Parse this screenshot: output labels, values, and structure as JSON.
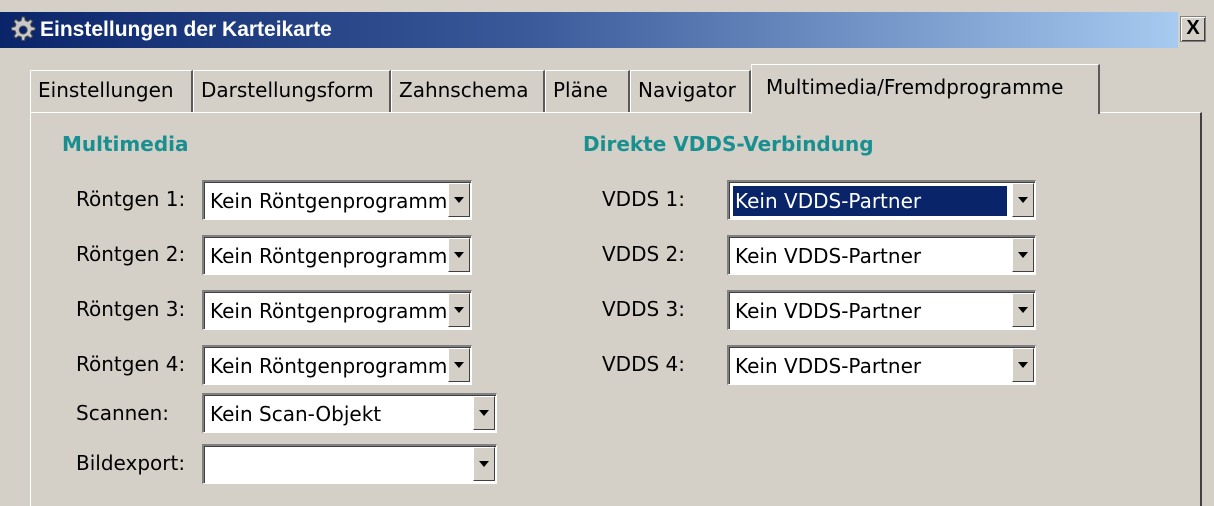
{
  "window": {
    "title": "Einstellungen der Karteikarte",
    "close_label": "X",
    "icon": "gear-icon"
  },
  "tabs": [
    {
      "label": "Einstellungen"
    },
    {
      "label": "Darstellungsform"
    },
    {
      "label": "Zahnschema"
    },
    {
      "label": "Pläne"
    },
    {
      "label": "Navigator"
    },
    {
      "label": "Multimedia/Fremdprogramme",
      "active": true
    }
  ],
  "multimedia": {
    "heading": "Multimedia",
    "fields": [
      {
        "label": "Röntgen 1:",
        "value": "Kein Röntgenprogramm"
      },
      {
        "label": "Röntgen 2:",
        "value": "Kein Röntgenprogramm"
      },
      {
        "label": "Röntgen 3:",
        "value": "Kein Röntgenprogramm"
      },
      {
        "label": "Röntgen 4:",
        "value": "Kein Röntgenprogramm"
      },
      {
        "label": "Scannen:",
        "value": "Kein Scan-Objekt"
      },
      {
        "label": "Bildexport:",
        "value": ""
      }
    ]
  },
  "vdds": {
    "heading": "Direkte VDDS-Verbindung",
    "fields": [
      {
        "label": "VDDS 1:",
        "value": "Kein VDDS-Partner",
        "focused": true
      },
      {
        "label": "VDDS 2:",
        "value": "Kein VDDS-Partner"
      },
      {
        "label": "VDDS 3:",
        "value": "Kein VDDS-Partner"
      },
      {
        "label": "VDDS 4:",
        "value": "Kein VDDS-Partner"
      }
    ]
  },
  "colors": {
    "title_gradient_start": "#0a246a",
    "title_gradient_end": "#a6caf0",
    "section_heading": "#1a8f8f",
    "dialog_face": "#d4d0c8",
    "selection": "#0a246a"
  },
  "icons": {
    "dropdown_arrow": "chevron-down-icon"
  }
}
